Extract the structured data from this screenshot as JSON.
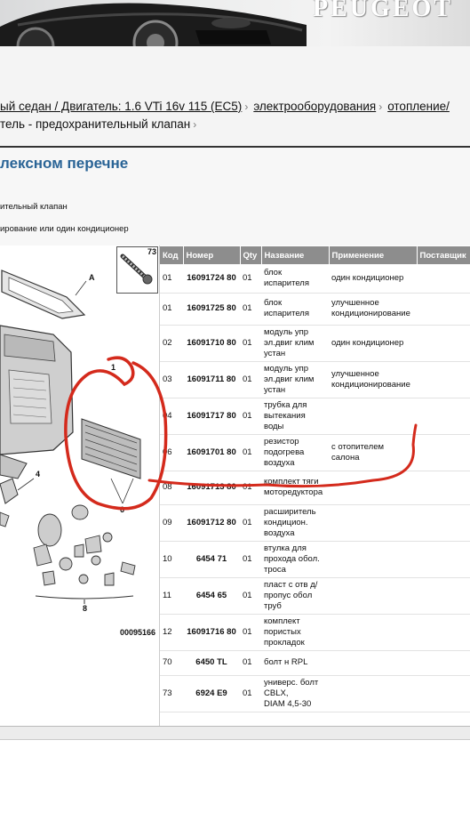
{
  "banner": {
    "brand": "PEUGEOT"
  },
  "breadcrumb": {
    "line1": [
      {
        "text": "ый седан / Двигатель: 1.6 VTi 16v 115 (EC5)",
        "link": true
      },
      {
        "text": "электрооборудования",
        "link": true
      },
      {
        "text": "отопление/",
        "link": true
      }
    ],
    "line2": "тель - предохранительный клапан"
  },
  "section": {
    "title": "лексном перечне",
    "line1": "ительный клапан",
    "line2": "ирование или один кондиционер"
  },
  "diagram": {
    "inset_number": "73",
    "code": "00095166",
    "callouts": [
      "A",
      "1",
      "4",
      "6",
      "8"
    ]
  },
  "table": {
    "headers": {
      "kod": "Код",
      "nomer": "Номер",
      "qty": "Qty",
      "name": "Название",
      "app": "Применение",
      "supplier": "Поставщик"
    },
    "rows": [
      {
        "kod": "01",
        "nomer": "16091724 80",
        "qty": "01",
        "name": "блок\nиспарителя",
        "app": "один кондиционер"
      },
      {
        "kod": "01",
        "nomer": "16091725 80",
        "qty": "01",
        "name": "блок\nиспарителя",
        "app": "улучшенное\nкондиционирование"
      },
      {
        "kod": "02",
        "nomer": "16091710 80",
        "qty": "01",
        "name": "модуль упр\nэл.двиг клим\nустан",
        "app": "один кондиционер"
      },
      {
        "kod": "03",
        "nomer": "16091711 80",
        "qty": "01",
        "name": "модуль упр\nэл.двиг клим\nустан",
        "app": "улучшенное\nкондиционирование"
      },
      {
        "kod": "04",
        "nomer": "16091717 80",
        "qty": "01",
        "name": "трубка для\nвытекания\nводы",
        "app": ""
      },
      {
        "kod": "06",
        "nomer": "16091701 80",
        "qty": "01",
        "name": "резистор\nподогрева\nвоздуха",
        "app": "с отопителем\nсалона"
      },
      {
        "kod": "08",
        "nomer": "16091713 80",
        "qty": "01",
        "name": "комплект тяги\nмоторедуктора",
        "app": ""
      },
      {
        "kod": "09",
        "nomer": "16091712 80",
        "qty": "01",
        "name": "расширитель\nкондицион.\nвоздуха",
        "app": ""
      },
      {
        "kod": "10",
        "nomer": "6454 71",
        "qty": "01",
        "name": "втулка для\nпрохода обол.\nтроса",
        "app": ""
      },
      {
        "kod": "11",
        "nomer": "6454 65",
        "qty": "01",
        "name": "пласт с отв д/\nпропус обол\nтруб",
        "app": ""
      },
      {
        "kod": "12",
        "nomer": "16091716 80",
        "qty": "01",
        "name": "комплект\nпористых\nпрокладок",
        "app": ""
      },
      {
        "kod": "70",
        "nomer": "6450 TL",
        "qty": "01",
        "name": "болт н RPL",
        "app": ""
      },
      {
        "kod": "73",
        "nomer": "6924 E9",
        "qty": "01",
        "name": "универс. болт\nCBLX,\nDIAM 4,5-30",
        "app": ""
      }
    ]
  },
  "colors": {
    "header_accent": "#2a6496",
    "table_header_bg": "#8d8d8d",
    "markup_red": "#d42a1c"
  }
}
